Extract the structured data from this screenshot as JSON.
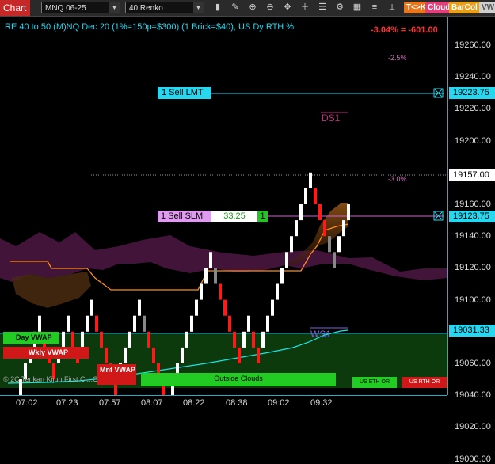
{
  "toolbar": {
    "tab_label": "Chart",
    "instrument": "MNQ 06-25",
    "bar_type": "40 Renko",
    "buttons": [
      "T<>K",
      "Cloud",
      "BarCol"
    ],
    "extra_button": "VW"
  },
  "header": {
    "strategy_text": "RE 40 to 50 (M)NQ Dec 20 (1%=150p=$300) (1 Brick=$40), US Dy RTH %",
    "pnl_text": "-3.04% = -601.00",
    "pct_label_top": "-2.5%",
    "pct_label_mid": "-3.0%"
  },
  "orders": {
    "sell_lmt_label": "1 Sell LMT",
    "sell_slm_label": "1 Sell SLM",
    "slm_pnl": "33.25",
    "slm_qty": "1",
    "sell_lmt_price": "19223.75",
    "sell_slm_price": "19123.75"
  },
  "markers": {
    "ds1": "DS1",
    "ws1": "WS1"
  },
  "price_boxes": {
    "last_price": "19157.00",
    "vwap_price": "19031.33"
  },
  "indicator_labels": {
    "day_vwap": "Day VWAP",
    "wkly_vwap": "Wkly VWAP",
    "mnt_vwap": "Mnt VWAP",
    "outside_clouds": "Outside Clouds",
    "us_eth_or": "US ETH OR",
    "us_rth_or": "US RTH OR",
    "copyright": "© 2C Tenkan Kijun First Cl...C"
  },
  "y_axis_ticks": [
    "19260.00",
    "19240.00",
    "19220.00",
    "19200.00",
    "19180.00",
    "19160.00",
    "19140.00",
    "19120.00",
    "19100.00",
    "19080.00",
    "19060.00",
    "19040.00",
    "19020.00",
    "19000.00"
  ],
  "x_axis_ticks": [
    "07:02",
    "07:23",
    "07:57",
    "08:07",
    "08:22",
    "08:38",
    "09:02",
    "09:32"
  ],
  "chart_data": {
    "type": "renko",
    "brick_size": 5,
    "y_range": [
      18985,
      19275
    ],
    "bricks": [
      [
        19040,
        19030,
        "r"
      ],
      [
        19040,
        19030,
        "r"
      ],
      [
        19050,
        19040,
        "w"
      ],
      [
        19060,
        19050,
        "w"
      ],
      [
        19070,
        19060,
        "w"
      ],
      [
        19080,
        19070,
        "w"
      ],
      [
        19090,
        19080,
        "w"
      ],
      [
        19080,
        19070,
        "r"
      ],
      [
        19070,
        19060,
        "r"
      ],
      [
        19060,
        19050,
        "r"
      ],
      [
        19070,
        19060,
        "w"
      ],
      [
        19080,
        19070,
        "w"
      ],
      [
        19090,
        19080,
        "w"
      ],
      [
        19080,
        19070,
        "r"
      ],
      [
        19070,
        19060,
        "r"
      ],
      [
        19080,
        19070,
        "w"
      ],
      [
        19090,
        19080,
        "w"
      ],
      [
        19100,
        19090,
        "w"
      ],
      [
        19090,
        19080,
        "r"
      ],
      [
        19080,
        19070,
        "r"
      ],
      [
        19070,
        19060,
        "r"
      ],
      [
        19060,
        19050,
        "r"
      ],
      [
        19050,
        19040,
        "r"
      ],
      [
        19060,
        19050,
        "w"
      ],
      [
        19070,
        19060,
        "w"
      ],
      [
        19080,
        19070,
        "w"
      ],
      [
        19090,
        19080,
        "w"
      ],
      [
        19100,
        19090,
        "w"
      ],
      [
        19090,
        19080,
        "g"
      ],
      [
        19080,
        19070,
        "r"
      ],
      [
        19070,
        19060,
        "r"
      ],
      [
        19060,
        19050,
        "r"
      ],
      [
        19050,
        19040,
        "r"
      ],
      [
        19040,
        19030,
        "r"
      ],
      [
        19050,
        19040,
        "w"
      ],
      [
        19060,
        19050,
        "w"
      ],
      [
        19070,
        19060,
        "w"
      ],
      [
        19080,
        19070,
        "w"
      ],
      [
        19090,
        19080,
        "w"
      ],
      [
        19100,
        19090,
        "w"
      ],
      [
        19110,
        19100,
        "w"
      ],
      [
        19120,
        19110,
        "w"
      ],
      [
        19130,
        19120,
        "w"
      ],
      [
        19120,
        19110,
        "g"
      ],
      [
        19110,
        19100,
        "r"
      ],
      [
        19100,
        19090,
        "r"
      ],
      [
        19090,
        19080,
        "r"
      ],
      [
        19080,
        19070,
        "r"
      ],
      [
        19070,
        19060,
        "r"
      ],
      [
        19080,
        19070,
        "w"
      ],
      [
        19090,
        19080,
        "w"
      ],
      [
        19080,
        19070,
        "r"
      ],
      [
        19070,
        19060,
        "r"
      ],
      [
        19080,
        19070,
        "w"
      ],
      [
        19090,
        19080,
        "w"
      ],
      [
        19100,
        19090,
        "w"
      ],
      [
        19110,
        19100,
        "w"
      ],
      [
        19120,
        19110,
        "w"
      ],
      [
        19130,
        19120,
        "w"
      ],
      [
        19140,
        19130,
        "w"
      ],
      [
        19150,
        19140,
        "w"
      ],
      [
        19160,
        19150,
        "w"
      ],
      [
        19170,
        19160,
        "w"
      ],
      [
        19180,
        19170,
        "w"
      ],
      [
        19170,
        19160,
        "r"
      ],
      [
        19160,
        19150,
        "r"
      ],
      [
        19150,
        19140,
        "r"
      ],
      [
        19140,
        19130,
        "g"
      ],
      [
        19130,
        19120,
        "g"
      ],
      [
        19140,
        19130,
        "w"
      ],
      [
        19150,
        19140,
        "w"
      ],
      [
        19160,
        19150,
        "w"
      ]
    ]
  },
  "colors": {
    "background": "#000000",
    "axis": "#2aa9c9",
    "cyan_text": "#27d7f0",
    "pnl_red": "#ff3030",
    "cloud_purple": "#5a1a4a",
    "cloud_brown": "#6a3a10",
    "kijun_orange": "#ff8c1a",
    "vwap_cyan": "#19e6e6",
    "green_band": "#0a3a0a"
  }
}
